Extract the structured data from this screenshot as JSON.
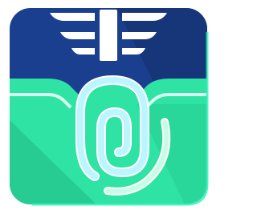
{
  "icon": {
    "name": "app-icon",
    "colors": {
      "top_band": "#1b3f8f",
      "top_band_shadow": "#163577",
      "body": "#2fe3a4",
      "body_shadow": "#24c28c",
      "symbol": "#bdf5ff",
      "symbol_stroke": "#ffffff",
      "border_glow": "#2df0b3"
    }
  }
}
